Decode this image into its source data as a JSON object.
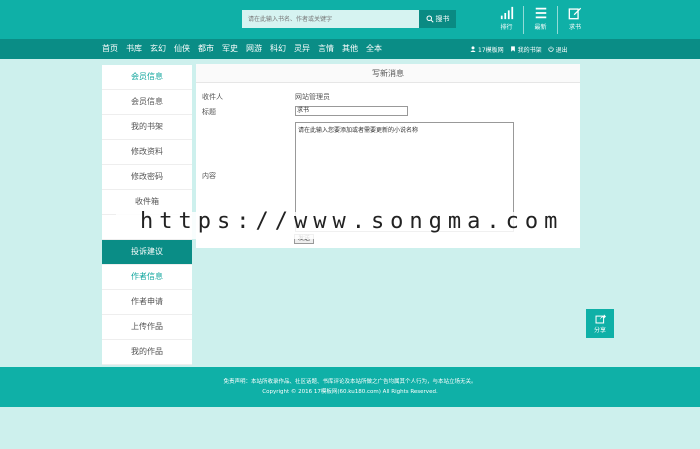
{
  "header": {
    "search": {
      "placeholder": "请在此输入书名、作者或关键字",
      "button_label": "搜书"
    },
    "top_icons": [
      {
        "icon": "bar-chart-icon",
        "label": "排行"
      },
      {
        "icon": "list-icon",
        "label": "最新"
      },
      {
        "icon": "edit-icon",
        "label": "求书"
      }
    ]
  },
  "nav": {
    "items": [
      "首页",
      "书库",
      "玄幻",
      "仙侠",
      "都市",
      "军史",
      "网游",
      "科幻",
      "灵异",
      "言情",
      "其他",
      "全本"
    ],
    "right": [
      {
        "icon": "user-icon",
        "label": "17模板网"
      },
      {
        "icon": "bookmark-icon",
        "label": "我的书架"
      },
      {
        "icon": "power-icon",
        "label": "退出"
      }
    ]
  },
  "sidebar": {
    "member_heading": "会员信息",
    "member_items": [
      "会员信息",
      "我的书架",
      "修改资料",
      "修改密码",
      "收件箱"
    ],
    "active_item": "投诉建议",
    "author_heading": "作者信息",
    "author_items": [
      "作者申请",
      "上传作品",
      "我的作品"
    ]
  },
  "message_form": {
    "title": "写新消息",
    "recipient_label": "收件人",
    "recipient_value": "网站管理员",
    "subject_label": "标题",
    "subject_value": "求书",
    "content_label": "内容",
    "content_value": "请在此输入您要添加或者需要更新的小说名称",
    "send_label": "发送"
  },
  "watermark": "https://www.songma.com",
  "share": {
    "label": "分享"
  },
  "footer": {
    "line1": "免责声明：本站所收录作品、社区话题、书库评论及本站所做之广告均属其个人行为，与本站立场无关。",
    "line2": "Copyright © 2016 17模板网(60.ku180.com) All Rights Reserved."
  },
  "colors": {
    "primary": "#0fb0a7",
    "primary_dark": "#0a8d86",
    "background": "#cdf0ed"
  }
}
